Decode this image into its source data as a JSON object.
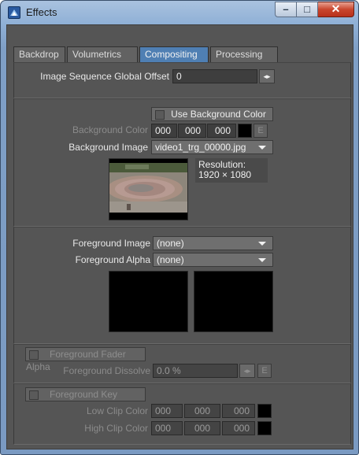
{
  "window": {
    "title": "Effects"
  },
  "tabs": [
    {
      "label": "Backdrop",
      "active": false
    },
    {
      "label": "Volumetrics",
      "active": false
    },
    {
      "label": "Compositing",
      "active": true
    },
    {
      "label": "Processing",
      "active": false
    }
  ],
  "offset": {
    "label": "Image Sequence Global Offset",
    "value": "0",
    "spin_icon": "◂▸"
  },
  "background": {
    "use_bg_color_label": "Use Background Color",
    "color_label": "Background Color",
    "color_r": "000",
    "color_g": "000",
    "color_b": "000",
    "e_label": "E",
    "image_label": "Background Image",
    "image_value": "video1_trg_00000.jpg",
    "resolution_label": "Resolution:",
    "resolution_value": "1920 × 1080"
  },
  "foreground": {
    "image_label": "Foreground Image",
    "image_value": "(none)",
    "alpha_label": "Foreground Alpha",
    "alpha_value": "(none)"
  },
  "fader": {
    "fader_alpha_label": "Foreground Fader Alpha",
    "dissolve_label": "Foreground Dissolve",
    "dissolve_value": "0.0 %",
    "spin_icon": "◂▸",
    "e_label": "E"
  },
  "key": {
    "key_label": "Foreground Key",
    "low_label": "Low Clip Color",
    "low_r": "000",
    "low_g": "000",
    "low_b": "000",
    "high_label": "High Clip Color",
    "high_r": "000",
    "high_g": "000",
    "high_b": "000"
  },
  "colors": {
    "accent_tab": "#4f7fb3",
    "panel_bg": "#555555"
  }
}
